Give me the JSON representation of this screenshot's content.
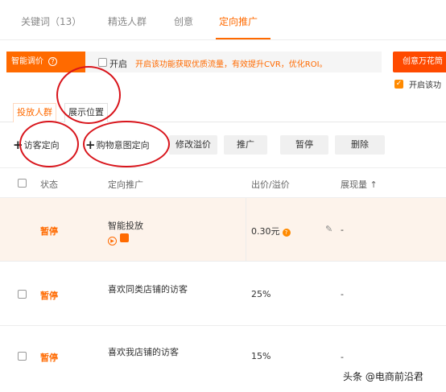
{
  "tabs": [
    {
      "label": "关键词（13）"
    },
    {
      "label": "精选人群"
    },
    {
      "label": "创意"
    },
    {
      "label": "定向推广"
    }
  ],
  "smart_bid": {
    "label": "智能调价",
    "icon": "info-icon",
    "toggle_label": "开启",
    "toggle_checked": false,
    "description": "开启该功能获取优质流量，有效提升CVR，优化ROI。"
  },
  "creative_button": {
    "label": "创意万花筒"
  },
  "creative_toggle": {
    "label": "开启该功",
    "checked": true
  },
  "subtabs": [
    {
      "label": "投放人群",
      "active": true
    },
    {
      "label": "展示位置",
      "active": false
    }
  ],
  "toolbar": {
    "visitor_targeting": "访客定向",
    "purchase_intent": "购物意图定向",
    "modify_premium": "修改溢价",
    "promote": "推广",
    "pause": "暂停",
    "delete": "删除"
  },
  "table": {
    "headers": {
      "status": "状态",
      "targeting": "定向推广",
      "bid": "出价/溢价",
      "exposure": "展现量 ↑"
    },
    "rows": [
      {
        "status": "暂停",
        "name": "智能投放",
        "bid": "0.30元",
        "exposure": "-",
        "highlight": true
      },
      {
        "status": "暂停",
        "name": "喜欢同类店铺的访客",
        "bid": "25%",
        "exposure": "-",
        "highlight": false
      },
      {
        "status": "暂停",
        "name": "喜欢我店铺的访客",
        "bid": "15%",
        "exposure": "-",
        "highlight": false
      }
    ]
  },
  "watermark": "头条 @电商前沿君",
  "colors": {
    "accent": "#ff6a00",
    "annotation": "#d8141b",
    "highlight_row": "#fdf3eb"
  }
}
